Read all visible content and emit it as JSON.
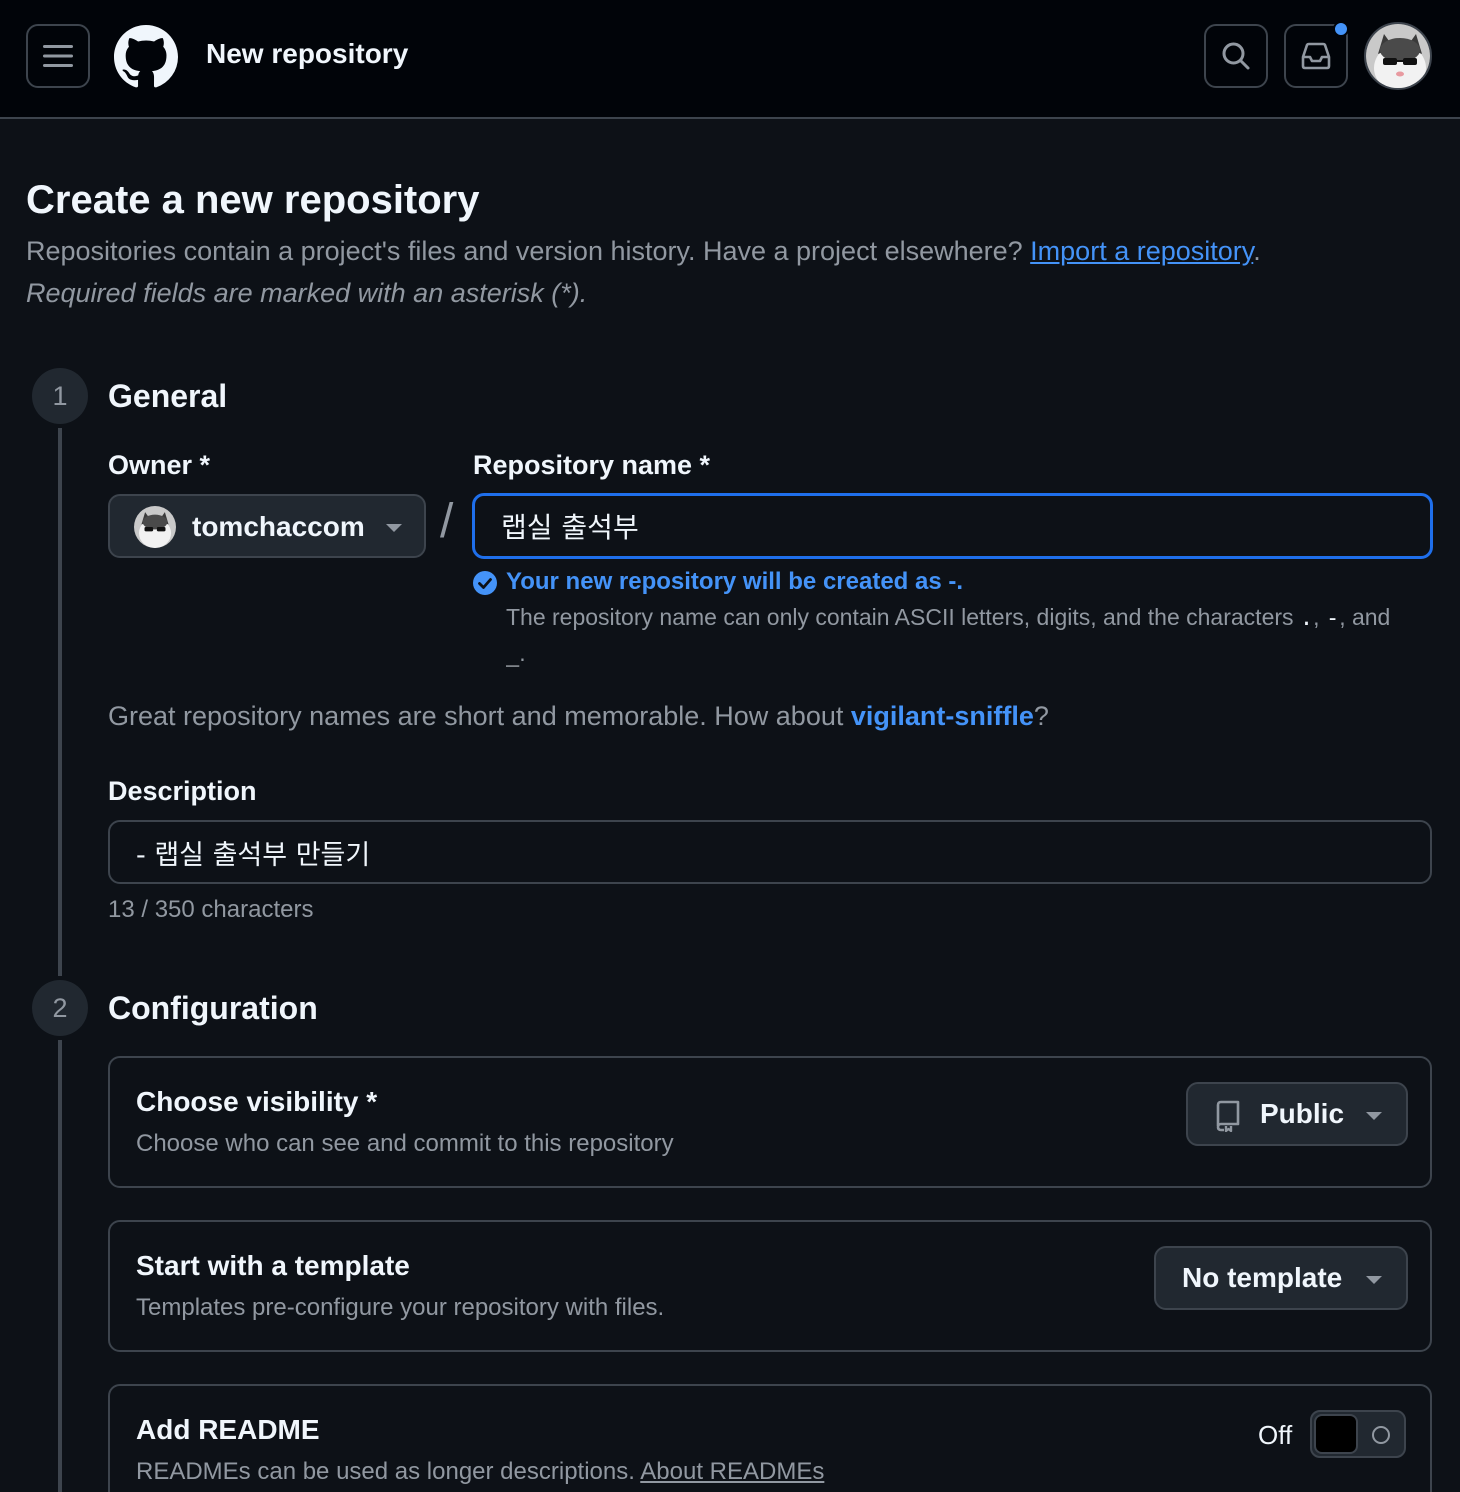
{
  "header": {
    "title": "New repository",
    "icons": [
      "hamburger-menu-icon",
      "github-logo-icon",
      "search-icon",
      "inbox-icon",
      "user-avatar"
    ]
  },
  "page": {
    "title": "Create a new repository",
    "subtitle": "Repositories contain a project's files and version history. Have a project elsewhere?",
    "import_link": "Import a repository",
    "subtitle_end": ".",
    "required_note": "Required fields are marked with an asterisk (*)."
  },
  "general": {
    "step": "1",
    "title": "General",
    "owner_label": "Owner *",
    "owner_value": "tomchaccom",
    "slash": "/",
    "repo_label": "Repository name *",
    "repo_value": "랩실 출석부",
    "valid_message": "Your new repository will be created as -.",
    "valid_note_prefix": "The repository name can only contain ASCII letters, digits, and the characters",
    "valid_char_1": ".",
    "valid_sep_1": ",",
    "valid_char_2": "-",
    "valid_sep_2": ", and",
    "valid_char_3": "_",
    "valid_end": ".",
    "suggest_prefix": "Great repository names are short and memorable. How about",
    "suggest_name": "vigilant-sniffle",
    "suggest_end": "?",
    "description_label": "Description",
    "description_value": "- 랩실 출석부 만들기",
    "char_count": "13 / 350 characters"
  },
  "configuration": {
    "step": "2",
    "title": "Configuration",
    "visibility": {
      "title": "Choose visibility *",
      "subtitle": "Choose who can see and commit to this repository",
      "value": "Public"
    },
    "template": {
      "title": "Start with a template",
      "subtitle": "Templates pre-configure your repository with files.",
      "value": "No template"
    },
    "readme": {
      "title": "Add README",
      "subtitle": "READMEs can be used as longer descriptions.",
      "link": "About READMEs",
      "toggle_label": "Off",
      "toggle_on": false
    }
  },
  "colors": {
    "background": "#0d1117",
    "header_bg": "#010409",
    "border": "#3d444d",
    "accent": "#4493f8",
    "muted": "#9198a1"
  }
}
